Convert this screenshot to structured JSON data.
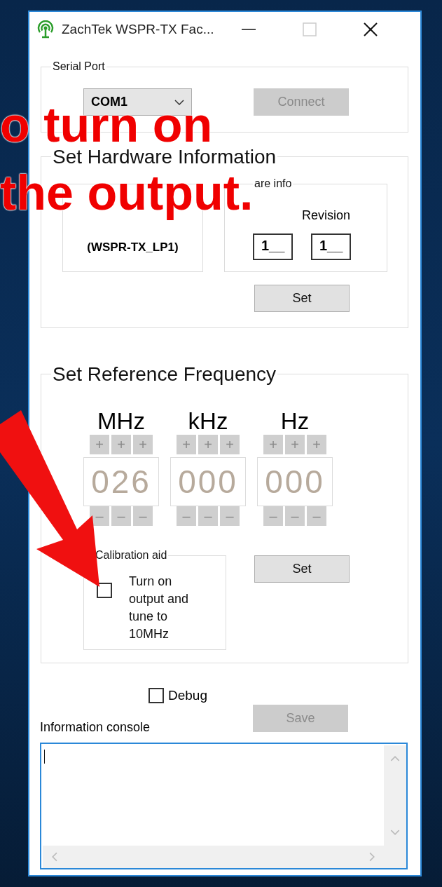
{
  "window": {
    "title": "ZachTek WSPR-TX Fac..."
  },
  "serial_port": {
    "label": "Serial Port",
    "port": "COM1",
    "connect_button": {
      "label": "Connect",
      "disabled": true
    }
  },
  "hardware": {
    "title": "Set Hardware Information",
    "product": {
      "name": "(WSPR-TX_LP1)"
    },
    "hardware_info": {
      "label": "are info",
      "revision_label": "Revision",
      "fields": [
        "1__",
        "1__"
      ]
    },
    "set_button": {
      "label": "Set",
      "disabled": false
    }
  },
  "reference": {
    "title": "Set Reference Frequency",
    "units": [
      {
        "unit": "MHz",
        "digits": "026",
        "plus": [
          "+",
          "+",
          "+"
        ],
        "minus": [
          "–",
          "–",
          "–"
        ]
      },
      {
        "unit": "kHz",
        "digits": "000",
        "plus": [
          "+",
          "+",
          "+"
        ],
        "minus": [
          "–",
          "–",
          "–"
        ]
      },
      {
        "unit": "Hz",
        "digits": "000",
        "plus": [
          "+",
          "+",
          "+"
        ],
        "minus": [
          "–",
          "–",
          "–"
        ]
      }
    ],
    "calibration": {
      "label": "Calibration aid",
      "checked": false,
      "text": "Turn on output and tune to 10MHz"
    },
    "set_button": {
      "label": "Set",
      "disabled": false
    }
  },
  "debug": {
    "label": "Debug",
    "checked": false
  },
  "console": {
    "label": "Information console",
    "save_button": {
      "label": "Save",
      "disabled": true
    }
  },
  "annotation": {
    "lines": [
      "o turn on",
      "the output."
    ]
  }
}
